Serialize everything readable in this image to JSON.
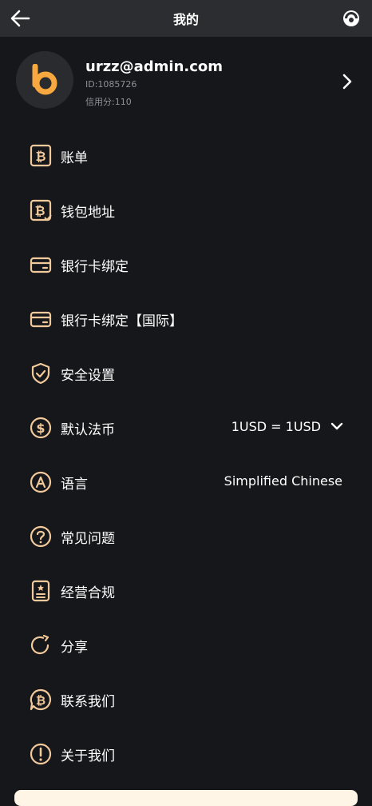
{
  "header": {
    "title": "我的",
    "back_icon": "arrow-left-icon",
    "support_icon": "customer-service-icon"
  },
  "profile": {
    "email": "urzz@admin.com",
    "id_text": "ID:1085726",
    "credit_text": "信用分:110",
    "avatar_icon": "bitget-logo-icon"
  },
  "menu": {
    "bill": "账单",
    "wallet": "钱包地址",
    "bank": "银行卡绑定",
    "bank_intl": "银行卡绑定【国际】",
    "security": "安全设置",
    "currency": "默认法币",
    "currency_value": "1USD = 1USD",
    "language": "语言",
    "language_value": "Simplified Chinese",
    "faq": "常见问题",
    "compliance": "经营合规",
    "share": "分享",
    "contact": "联系我们",
    "about": "关于我们"
  },
  "colors": {
    "accent": "#f7a940",
    "icon_stroke": "#f2c99a",
    "background": "#16171b",
    "header_bg": "#2c2d31"
  }
}
